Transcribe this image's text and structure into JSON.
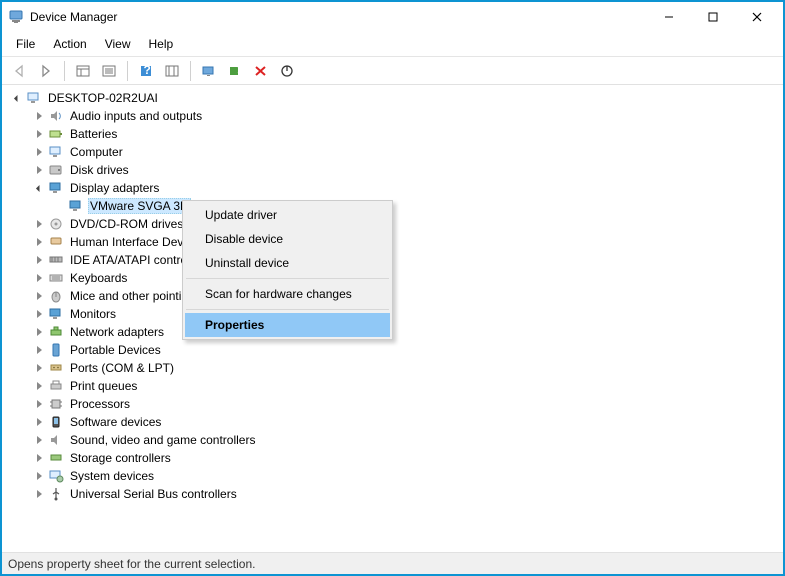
{
  "window": {
    "title": "Device Manager"
  },
  "menu": {
    "file": "File",
    "action": "Action",
    "view": "View",
    "help": "Help"
  },
  "tree": {
    "root": "DESKTOP-02R2UAI",
    "categories": [
      "Audio inputs and outputs",
      "Batteries",
      "Computer",
      "Disk drives",
      "Display adapters",
      "DVD/CD-ROM drives",
      "Human Interface Devices",
      "IDE ATA/ATAPI controllers",
      "Keyboards",
      "Mice and other pointing devices",
      "Monitors",
      "Network adapters",
      "Portable Devices",
      "Ports (COM & LPT)",
      "Print queues",
      "Processors",
      "Software devices",
      "Sound, video and game controllers",
      "Storage controllers",
      "System devices",
      "Universal Serial Bus controllers"
    ],
    "display_child": "VMware SVGA 3D"
  },
  "context_menu": {
    "update": "Update driver",
    "disable": "Disable device",
    "uninstall": "Uninstall device",
    "scan": "Scan for hardware changes",
    "properties": "Properties"
  },
  "status": "Opens property sheet for the current selection."
}
